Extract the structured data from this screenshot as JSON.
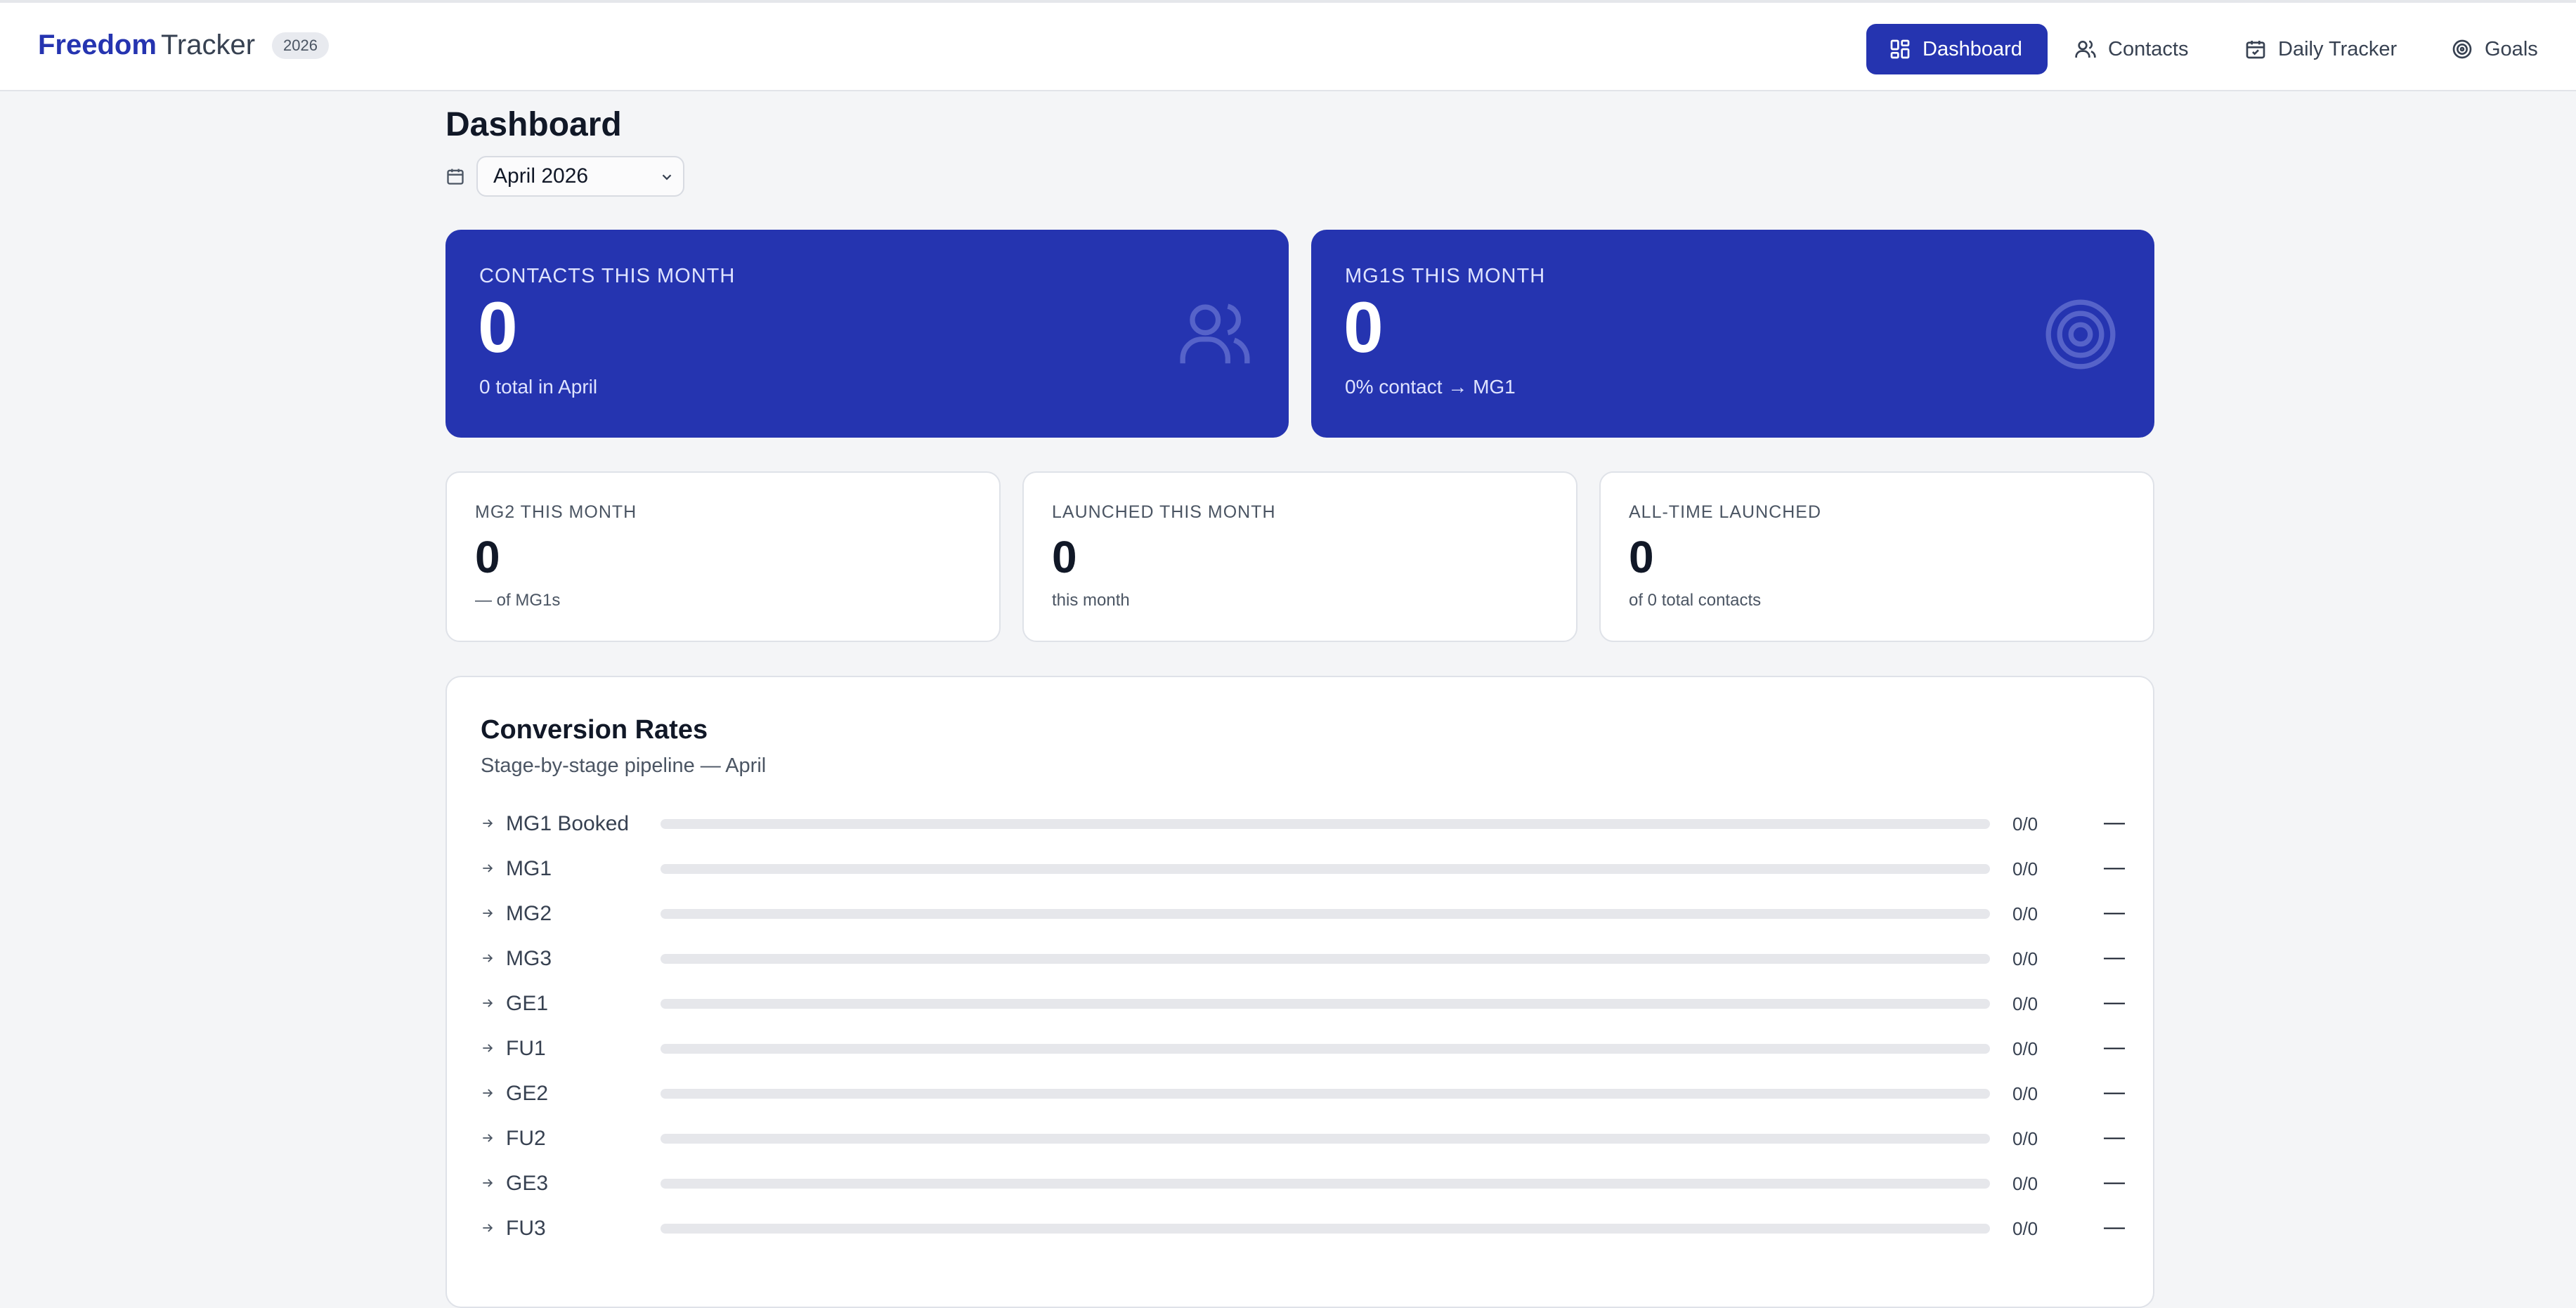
{
  "brand": {
    "strong": "Freedom",
    "light": "Tracker",
    "year_badge": "2026"
  },
  "nav": [
    {
      "label": "Dashboard",
      "icon": "dashboard-icon",
      "active": true
    },
    {
      "label": "Contacts",
      "icon": "users-icon",
      "active": false
    },
    {
      "label": "Daily Tracker",
      "icon": "calendar-icon",
      "active": false
    },
    {
      "label": "Goals",
      "icon": "target-icon",
      "active": false
    }
  ],
  "page": {
    "title": "Dashboard",
    "month_select": "April 2026"
  },
  "big_cards": [
    {
      "label": "CONTACTS THIS MONTH",
      "value": "0",
      "sub": "0 total in April",
      "icon": "users-icon"
    },
    {
      "label": "MG1S THIS MONTH",
      "value": "0",
      "sub": "0% contact → MG1",
      "icon": "target-icon"
    }
  ],
  "small_cards": [
    {
      "label": "MG2 THIS MONTH",
      "value": "0",
      "sub": "— of MG1s"
    },
    {
      "label": "LAUNCHED THIS MONTH",
      "value": "0",
      "sub": "this month"
    },
    {
      "label": "ALL-TIME LAUNCHED",
      "value": "0",
      "sub": "of 0 total contacts"
    }
  ],
  "conversion": {
    "title": "Conversion Rates",
    "subtitle": "Stage-by-stage pipeline — April",
    "rows": [
      {
        "name": "MG1 Booked",
        "ratio": "0/0",
        "pct": "—",
        "progress": 0
      },
      {
        "name": "MG1",
        "ratio": "0/0",
        "pct": "—",
        "progress": 0
      },
      {
        "name": "MG2",
        "ratio": "0/0",
        "pct": "—",
        "progress": 0
      },
      {
        "name": "MG3",
        "ratio": "0/0",
        "pct": "—",
        "progress": 0
      },
      {
        "name": "GE1",
        "ratio": "0/0",
        "pct": "—",
        "progress": 0
      },
      {
        "name": "FU1",
        "ratio": "0/0",
        "pct": "—",
        "progress": 0
      },
      {
        "name": "GE2",
        "ratio": "0/0",
        "pct": "—",
        "progress": 0
      },
      {
        "name": "FU2",
        "ratio": "0/0",
        "pct": "—",
        "progress": 0
      },
      {
        "name": "GE3",
        "ratio": "0/0",
        "pct": "—",
        "progress": 0
      },
      {
        "name": "FU3",
        "ratio": "0/0",
        "pct": "—",
        "progress": 0
      }
    ]
  },
  "colors": {
    "accent": "#2534b0",
    "background": "#f4f5f7",
    "track": "#e6e7eb"
  }
}
